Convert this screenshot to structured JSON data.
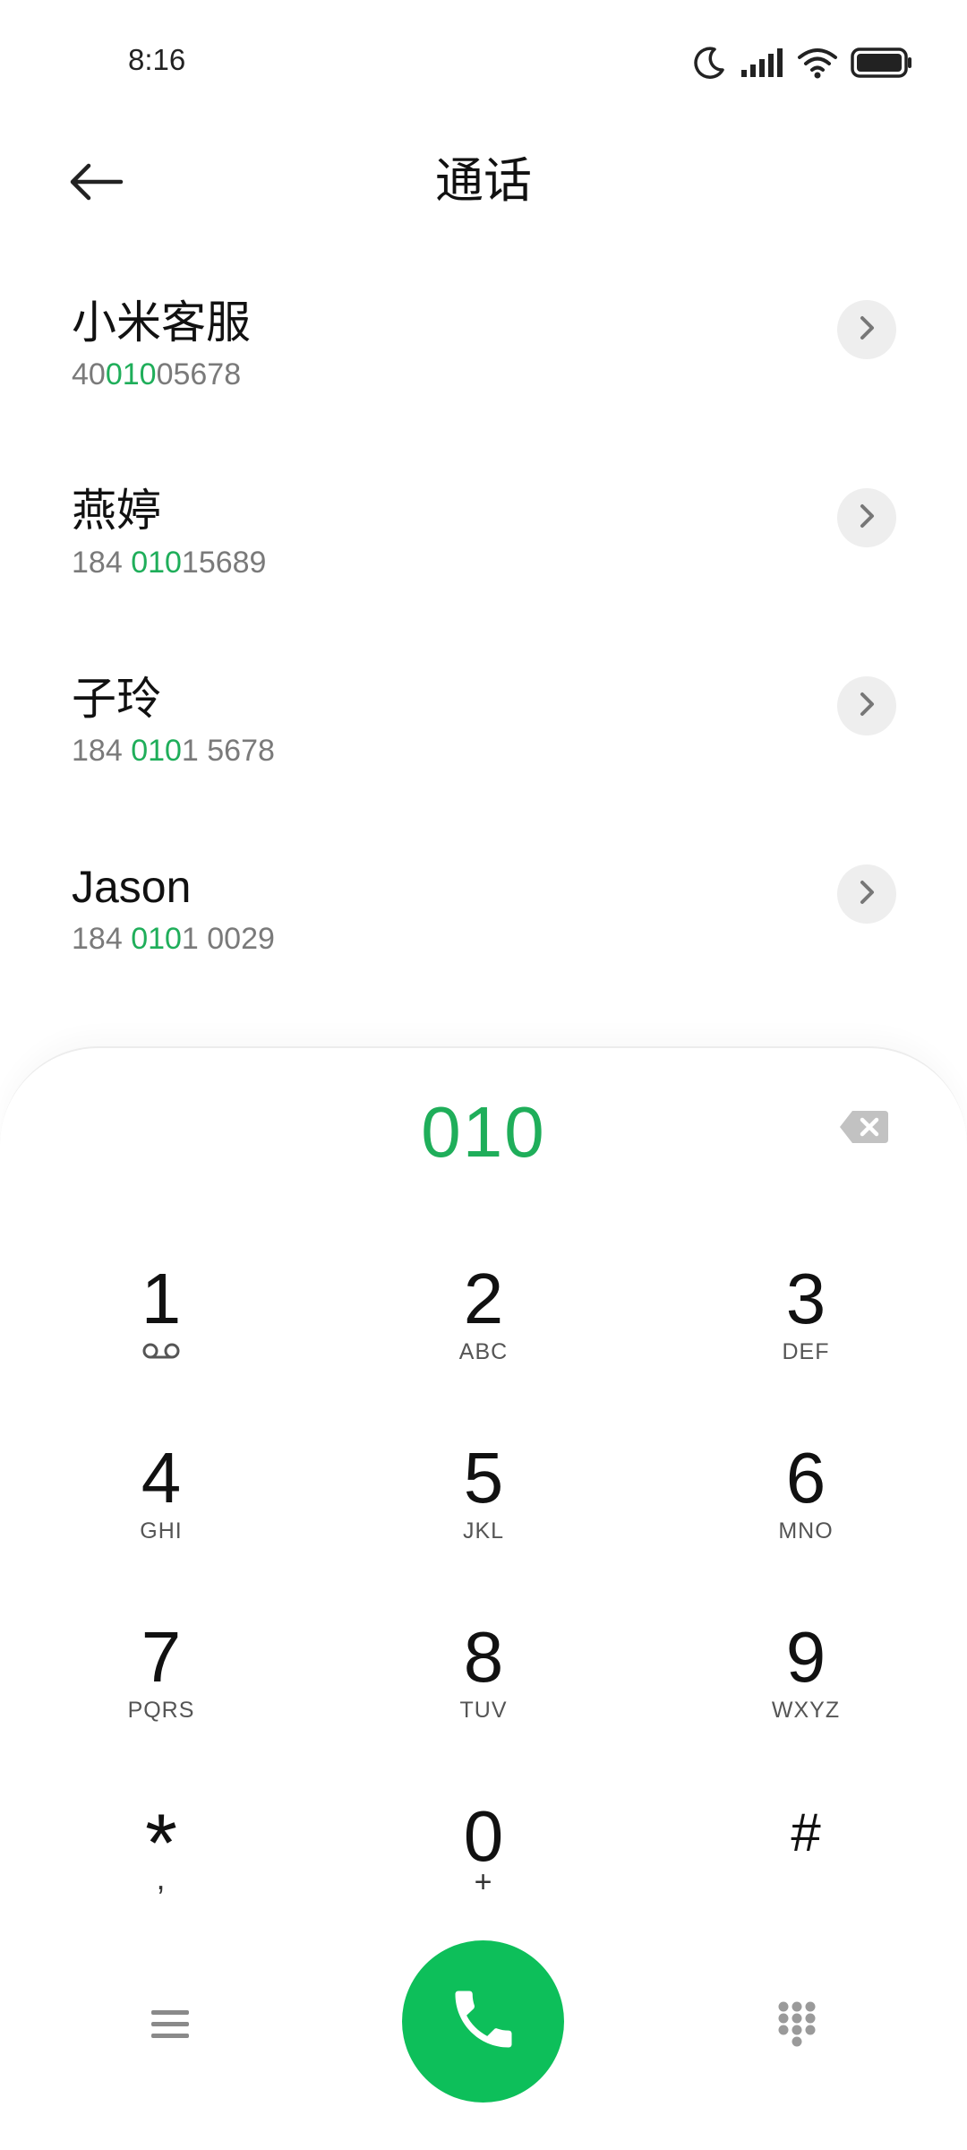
{
  "status_bar": {
    "time": "8:16",
    "icons": [
      "moon-icon",
      "signal-icon",
      "wifi-icon",
      "battery-icon"
    ]
  },
  "header": {
    "title": "通话",
    "back_icon": "back-arrow-icon"
  },
  "contacts": [
    {
      "name": "小米客服",
      "number_prefix": "40",
      "number_match": "010",
      "number_suffix": "05678"
    },
    {
      "name": "燕婷",
      "number_prefix": "184 ",
      "number_match": "010",
      "number_suffix": "15689"
    },
    {
      "name": "子玲",
      "number_prefix": "184 ",
      "number_match": "010",
      "number_suffix": "1 5678"
    },
    {
      "name": "Jason",
      "number_prefix": "184 ",
      "number_match": "010",
      "number_suffix": "1 0029"
    }
  ],
  "dialer": {
    "input": "010",
    "keys": [
      {
        "digit": "1",
        "sub": ""
      },
      {
        "digit": "2",
        "sub": "ABC"
      },
      {
        "digit": "3",
        "sub": "DEF"
      },
      {
        "digit": "4",
        "sub": "GHI"
      },
      {
        "digit": "5",
        "sub": "JKL"
      },
      {
        "digit": "6",
        "sub": "MNO"
      },
      {
        "digit": "7",
        "sub": "PQRS"
      },
      {
        "digit": "8",
        "sub": "TUV"
      },
      {
        "digit": "9",
        "sub": "WXYZ"
      },
      {
        "digit": "*",
        "sub": ","
      },
      {
        "digit": "0",
        "sub": "+"
      },
      {
        "digit": "#",
        "sub": ""
      }
    ]
  },
  "colors": {
    "accent_green": "#1fae5a",
    "call_button": "#0dbf5a",
    "secondary_text": "#7a7a7a"
  }
}
